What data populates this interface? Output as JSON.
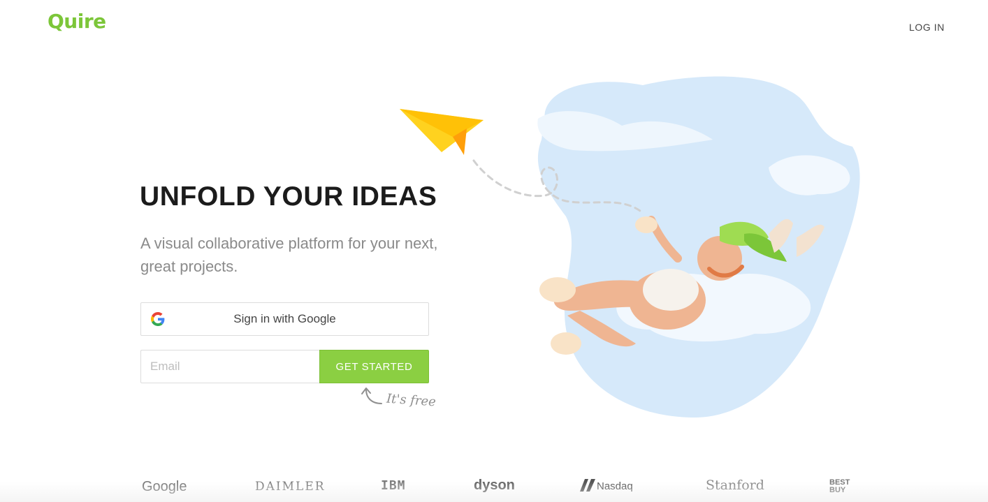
{
  "header": {
    "logo_text": "Quire",
    "login_label": "LOG IN"
  },
  "hero": {
    "title": "UNFOLD YOUR IDEAS",
    "subtitle": "A visual collaborative platform for your next, great projects."
  },
  "signup": {
    "google_label": "Sign in with Google",
    "email_placeholder": "Email",
    "email_value": "",
    "cta_label": "GET STARTED",
    "free_note": "It's free"
  },
  "brands": {
    "items": [
      "Google",
      "DAIMLER",
      "IBM",
      "dyson",
      "Nasdaq",
      "Stanford",
      "BEST BUY"
    ]
  },
  "colors": {
    "brand_green": "#7cc639",
    "cta_green": "#8bcf42",
    "sky_blue": "#d6e9fa",
    "paper_plane_yellow": "#ffd21f"
  },
  "icons": {
    "google": "google-g-icon",
    "plane": "paper-plane-icon",
    "arrow": "curved-arrow-icon",
    "nasdaq": "nasdaq-mark-icon"
  }
}
